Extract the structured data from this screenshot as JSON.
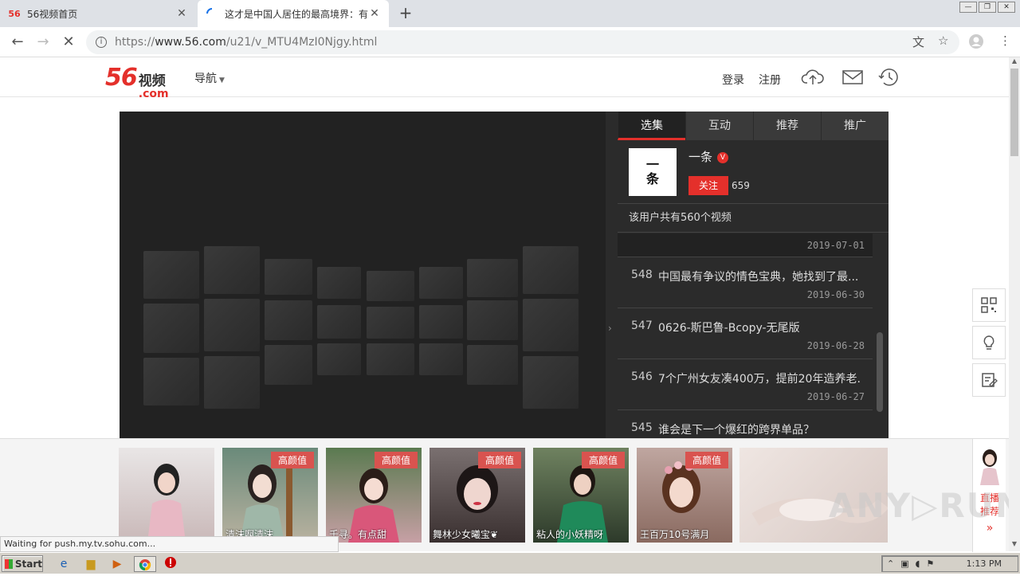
{
  "browser": {
    "tabs": [
      {
        "favicon": "56",
        "title": "56视频首页",
        "active": false
      },
      {
        "favicon": "loading",
        "title": "这才是中国人居住的最高境界：有水有",
        "active": true
      }
    ],
    "url_prefix": "https://",
    "url_host": "www.56.com",
    "url_path": "/u21/v_MTU4MzI0Njgy.html",
    "status_text": "Waiting for push.my.tv.sohu.com..."
  },
  "site": {
    "logo_num": "56",
    "logo_cn": "视频",
    "logo_com": ".com",
    "nav_label": "导航",
    "login": "登录",
    "register": "注册"
  },
  "panel": {
    "tabs": [
      "选集",
      "互动",
      "推荐",
      "推广"
    ],
    "active_tab": 0,
    "user": {
      "avatar_text_1": "一",
      "avatar_text_2": "条",
      "name": "一条",
      "follow_label": "关注",
      "followers": "659"
    },
    "video_count_text": "该用户共有560个视频",
    "videos": [
      {
        "num": "",
        "title": "",
        "date": "2019-07-01"
      },
      {
        "num": "548",
        "title": "中国最有争议的情色宝典，她找到了最...",
        "date": "2019-06-30"
      },
      {
        "num": "547",
        "title": "0626-斯巴鲁-Bcopy-无尾版",
        "date": "2019-06-28"
      },
      {
        "num": "546",
        "title": "7个广州女友凑400万，提前20年造养老...",
        "date": "2019-06-27"
      },
      {
        "num": "545",
        "title": "谁会是下一个爆红的跨界单品？",
        "date": ""
      }
    ]
  },
  "live": {
    "tag": "高颜值",
    "items": [
      {
        "caption": "",
        "tag": false
      },
      {
        "caption": "清沫啊清沫",
        "tag": true
      },
      {
        "caption": "千寻。有点甜",
        "tag": true
      },
      {
        "caption": "舞林少女曦宝❦",
        "tag": true
      },
      {
        "caption": "粘人的小妖精呀",
        "tag": true
      },
      {
        "caption": "王百万10号满月",
        "tag": true
      },
      {
        "caption": "",
        "tag": false
      }
    ],
    "side_1": "直播",
    "side_2": "推荐",
    "side_arrow": "»"
  },
  "watermark": "ANY▷RUN",
  "taskbar": {
    "start": "Start",
    "time": "1:13 PM"
  },
  "colors": {
    "brand_red": "#e4302b",
    "panel_bg": "#2b2b2b",
    "player_bg": "#222222",
    "tag_red": "#d9534f"
  }
}
